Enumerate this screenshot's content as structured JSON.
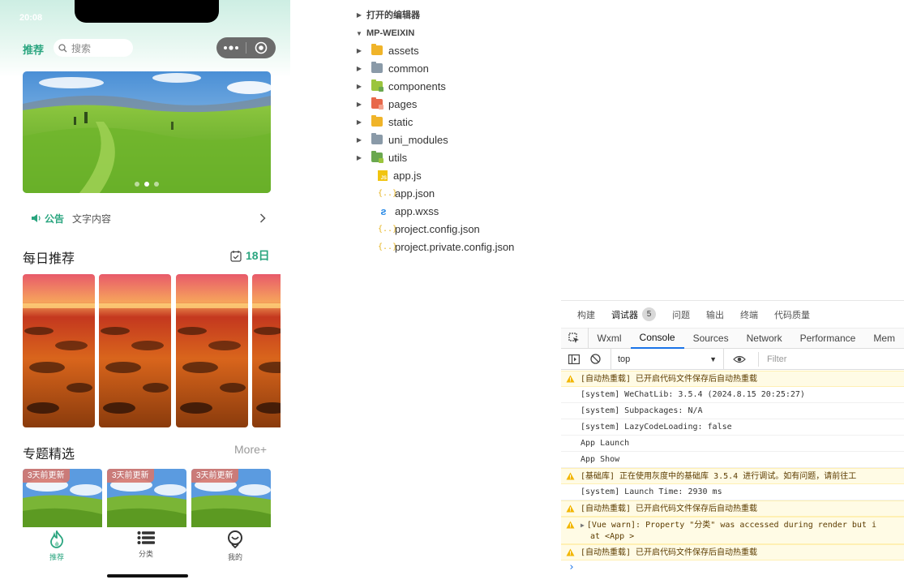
{
  "phone": {
    "status_time": "20:08",
    "nav_tab": "推荐",
    "search_placeholder": "搜索",
    "notice_label": "公告",
    "notice_text": "文字内容",
    "daily_title": "每日推荐",
    "daily_date": "18日",
    "topic_title": "专题精选",
    "topic_more": "More+",
    "topic_tags": [
      "3天前更新",
      "3天前更新",
      "3天前更新"
    ],
    "tabbar": [
      {
        "label": "推荐",
        "icon": "flame-icon"
      },
      {
        "label": "分类",
        "icon": "list-icon"
      },
      {
        "label": "我的",
        "icon": "profile-icon"
      }
    ],
    "colors": {
      "accent": "#2aa57f"
    }
  },
  "explorer": {
    "open_editors": "打开的编辑器",
    "project": "MP-WEIXIN",
    "folders": [
      {
        "name": "assets",
        "color": "#f0b429",
        "badge": ""
      },
      {
        "name": "common",
        "color": "#8a9aa8",
        "badge": ""
      },
      {
        "name": "components",
        "color": "#9bc53d",
        "badge": "#6aa84f"
      },
      {
        "name": "pages",
        "color": "#e8684a",
        "badge": "#f4a38f"
      },
      {
        "name": "static",
        "color": "#f0b429",
        "badge": ""
      },
      {
        "name": "uni_modules",
        "color": "#8a9aa8",
        "badge": ""
      },
      {
        "name": "utils",
        "color": "#6aa84f",
        "badge": "#9bc53d"
      }
    ],
    "files": [
      {
        "name": "app.js",
        "type": "js"
      },
      {
        "name": "app.json",
        "type": "json"
      },
      {
        "name": "app.wxss",
        "type": "css"
      },
      {
        "name": "project.config.json",
        "type": "json"
      },
      {
        "name": "project.private.config.json",
        "type": "json"
      }
    ]
  },
  "devtools": {
    "top_tabs": [
      "构建",
      "调试器",
      "问题",
      "输出",
      "终端",
      "代码质量"
    ],
    "debugger_badge": "5",
    "panel_tabs": [
      "Wxml",
      "Console",
      "Sources",
      "Network",
      "Performance",
      "Mem"
    ],
    "context": "top",
    "filter_placeholder": "Filter",
    "logs": [
      {
        "type": "warn",
        "text": "[自动热重载] 已开启代码文件保存后自动热重载"
      },
      {
        "type": "info",
        "text": "[system] WeChatLib: 3.5.4 (2024.8.15 20:25:27)"
      },
      {
        "type": "info",
        "text": "[system] Subpackages: N/A"
      },
      {
        "type": "info",
        "text": "[system] LazyCodeLoading: false"
      },
      {
        "type": "info",
        "text": "App Launch"
      },
      {
        "type": "info",
        "text": "App Show"
      },
      {
        "type": "warn",
        "text": "[基础库] 正在使用灰度中的基础库 3.5.4 进行调试。如有问题，请前往工"
      },
      {
        "type": "info",
        "text": "[system] Launch Time: 2930 ms"
      },
      {
        "type": "warn",
        "text": "[自动热重载] 已开启代码文件保存后自动热重载"
      },
      {
        "type": "warn-expand",
        "text": "[Vue warn]: Property \"分类\" was accessed during render but i",
        "text2": "at <App >"
      },
      {
        "type": "warn",
        "text": "[自动热重载] 已开启代码文件保存后自动热重载"
      }
    ],
    "prompt": "›"
  }
}
